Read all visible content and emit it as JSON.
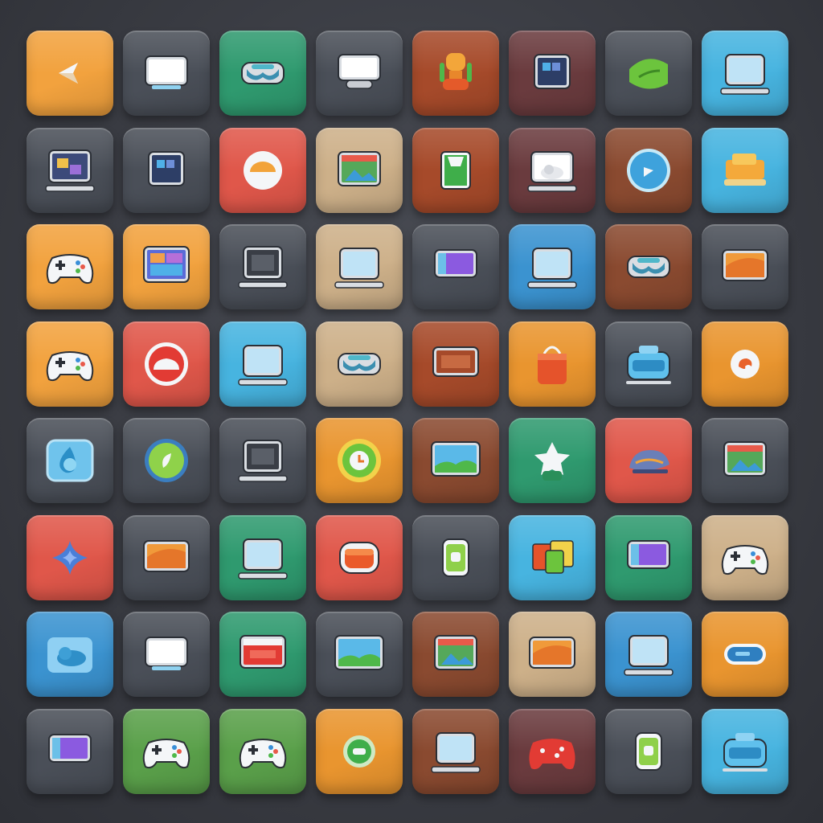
{
  "palette": {
    "orange": "#f2a23e",
    "gray": "#4a4f58",
    "green": "#2f9a6f",
    "rust": "#a64a2a",
    "maroon": "#6a3b3e",
    "sky": "#47b4e0",
    "red": "#e0574a",
    "tan": "#cdb089",
    "blue": "#3b93d0",
    "leaf": "#5aa04a",
    "brown": "#8a4a30",
    "amber": "#e9952f"
  },
  "tiles": [
    [
      "orange",
      "arrow-icon"
    ],
    [
      "gray",
      "monitor-icon"
    ],
    [
      "green",
      "vr-headset-icon"
    ],
    [
      "gray",
      "console-icon"
    ],
    [
      "rust",
      "robot-icon"
    ],
    [
      "maroon",
      "tablet-icon"
    ],
    [
      "gray",
      "leaf-card-icon"
    ],
    [
      "sky",
      "laptop-icon"
    ],
    [
      "gray",
      "photo-laptop-icon"
    ],
    [
      "gray",
      "tablet-icon"
    ],
    [
      "red",
      "bowl-icon"
    ],
    [
      "tan",
      "photo-frame-icon"
    ],
    [
      "rust",
      "card-device-icon"
    ],
    [
      "maroon",
      "cloud-laptop-icon"
    ],
    [
      "brown",
      "play-circle-icon"
    ],
    [
      "sky",
      "cart-icon"
    ],
    [
      "orange",
      "gamepad-icon"
    ],
    [
      "orange",
      "window-icon"
    ],
    [
      "gray",
      "computer-icon"
    ],
    [
      "tan",
      "laptop-icon"
    ],
    [
      "gray",
      "purple-device-icon"
    ],
    [
      "blue",
      "laptop-icon"
    ],
    [
      "brown",
      "vr-headset-icon"
    ],
    [
      "gray",
      "orange-screen-icon"
    ],
    [
      "orange",
      "gamepad-icon"
    ],
    [
      "red",
      "cloud-circle-icon"
    ],
    [
      "sky",
      "laptop-icon"
    ],
    [
      "tan",
      "vr-headset-icon"
    ],
    [
      "rust",
      "screen-icon"
    ],
    [
      "amber",
      "bag-icon"
    ],
    [
      "gray",
      "camera-icon"
    ],
    [
      "amber",
      "swirl-icon"
    ],
    [
      "gray",
      "water-drop-icon"
    ],
    [
      "gray",
      "leaf-circle-icon"
    ],
    [
      "gray",
      "computer-icon"
    ],
    [
      "amber",
      "clock-circle-icon"
    ],
    [
      "brown",
      "landscape-icon"
    ],
    [
      "green",
      "star-icon"
    ],
    [
      "red",
      "hat-icon"
    ],
    [
      "gray",
      "photo-frame-icon"
    ],
    [
      "red",
      "sparkle-icon"
    ],
    [
      "gray",
      "orange-screen-icon"
    ],
    [
      "green",
      "laptop-icon"
    ],
    [
      "red",
      "toaster-icon"
    ],
    [
      "gray",
      "phone-icon"
    ],
    [
      "sky",
      "cards-icon"
    ],
    [
      "green",
      "purple-device-icon"
    ],
    [
      "tan",
      "gamepad-icon"
    ],
    [
      "blue",
      "cloud-icon"
    ],
    [
      "gray",
      "monitor-icon"
    ],
    [
      "green",
      "red-screen-icon"
    ],
    [
      "gray",
      "landscape-icon"
    ],
    [
      "brown",
      "photo-frame-icon"
    ],
    [
      "tan",
      "orange-screen-icon"
    ],
    [
      "blue",
      "laptop-icon"
    ],
    [
      "amber",
      "capsule-icon"
    ],
    [
      "gray",
      "purple-device-icon"
    ],
    [
      "leaf",
      "gamepad-icon"
    ],
    [
      "leaf",
      "gamepad-icon"
    ],
    [
      "amber",
      "chat-icon"
    ],
    [
      "brown",
      "laptop-icon"
    ],
    [
      "maroon",
      "puzzle-gamepad-icon"
    ],
    [
      "gray",
      "phone-icon"
    ],
    [
      "sky",
      "camera-icon"
    ]
  ]
}
